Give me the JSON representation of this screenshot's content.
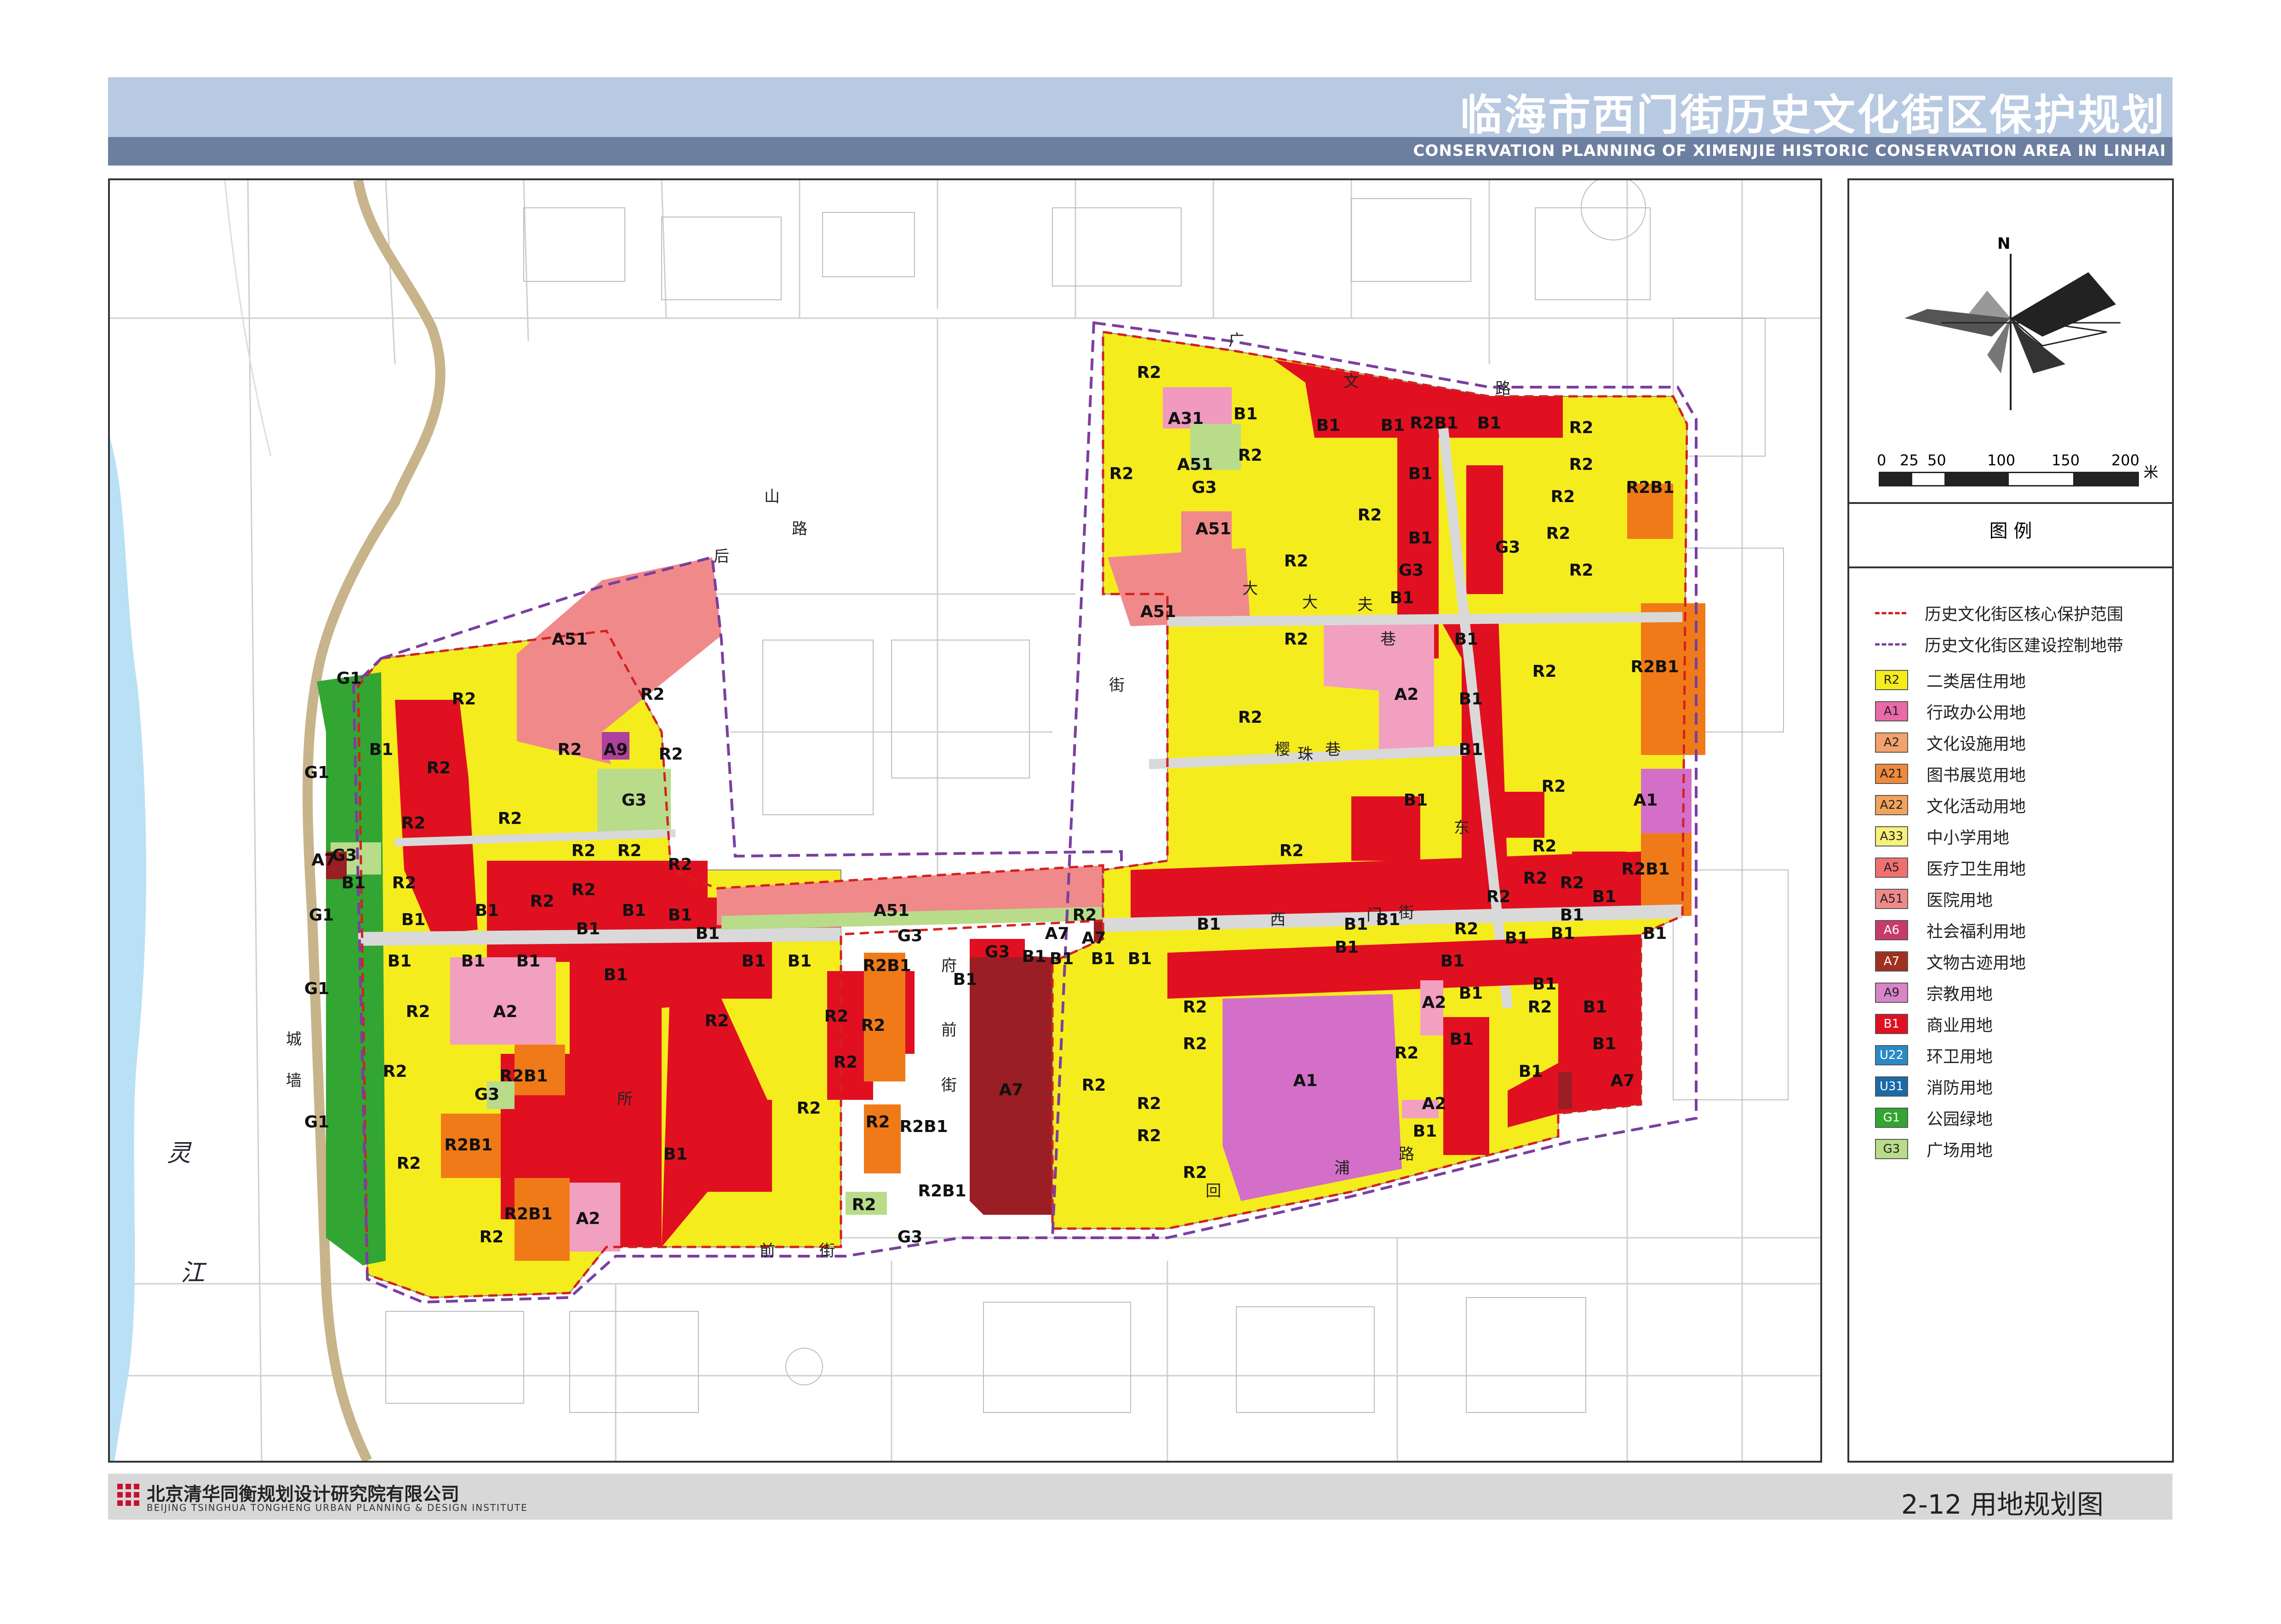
{
  "header": {
    "title": "临海市西门街历史文化街区保护规划",
    "subtitle": "CONSERVATION PLANNING OF XIMENJIE HISTORIC CONSERVATION AREA IN LINHAI"
  },
  "compass": {
    "north": "N"
  },
  "scale_bar": {
    "ticks": [
      "0",
      "25",
      "50",
      "100",
      "150",
      "200"
    ],
    "unit": "米"
  },
  "legend": {
    "title": "图 例",
    "lines": [
      {
        "label": "历史文化街区核心保护范围",
        "color": "#d42020"
      },
      {
        "label": "历史文化街区建设控制地带",
        "color": "#7a3fa0"
      }
    ],
    "items": [
      {
        "code": "R2",
        "label": "二类居住用地",
        "color": "#f5ec1e"
      },
      {
        "code": "A1",
        "label": "行政办公用地",
        "color": "#e86aa8"
      },
      {
        "code": "A2",
        "label": "文化设施用地",
        "color": "#f2a36b"
      },
      {
        "code": "A21",
        "label": "图书展览用地",
        "color": "#f08a3a"
      },
      {
        "code": "A22",
        "label": "文化活动用地",
        "color": "#f3a45a"
      },
      {
        "code": "A33",
        "label": "中小学用地",
        "color": "#f7f07a"
      },
      {
        "code": "A5",
        "label": "医疗卫生用地",
        "color": "#f07070"
      },
      {
        "code": "A51",
        "label": "医院用地",
        "color": "#f08a8a"
      },
      {
        "code": "A6",
        "label": "社会福利用地",
        "color": "#c83a6a"
      },
      {
        "code": "A7",
        "label": "文物古迹用地",
        "color": "#a03020"
      },
      {
        "code": "A9",
        "label": "宗教用地",
        "color": "#d884c8"
      },
      {
        "code": "B1",
        "label": "商业用地",
        "color": "#e01020"
      },
      {
        "code": "U22",
        "label": "环卫用地",
        "color": "#2a8ac8"
      },
      {
        "code": "U31",
        "label": "消防用地",
        "color": "#1a6aa8"
      },
      {
        "code": "G1",
        "label": "公园绿地",
        "color": "#33a532"
      },
      {
        "code": "G3",
        "label": "广场用地",
        "color": "#b8dc8a"
      }
    ]
  },
  "map": {
    "streets": [
      "广",
      "文",
      "路",
      "山",
      "后",
      "路",
      "大",
      "夫",
      "巷",
      "街",
      "樱",
      "珠",
      "巷",
      "西",
      "门",
      "街",
      "府",
      "前",
      "街",
      "回",
      "浦",
      "路",
      "城",
      "墙",
      "灵",
      "江",
      "所",
      "前",
      "街",
      "东",
      "大"
    ],
    "colors": {
      "R2": "#f5ec1e",
      "B1": "#e01020",
      "A1": "#d36fc8",
      "A2": "#f2a0c0",
      "A51": "#f08a8a",
      "A31": "#f09ac0",
      "A7": "#9a1e24",
      "A9": "#b040a0",
      "R2B1": "#f07a18",
      "G1": "#33a532",
      "G3": "#b8dc8a",
      "river": "#b9e0f5",
      "wall": "#c8b48a"
    }
  },
  "footer": {
    "org_cn": "北京清华同衡规划设计研究院有限公司",
    "org_en": "BEIJING TSINGHUA TONGHENG URBAN PLANNING & DESIGN INSTITUTE",
    "figure": "2-12 用地规划图"
  }
}
